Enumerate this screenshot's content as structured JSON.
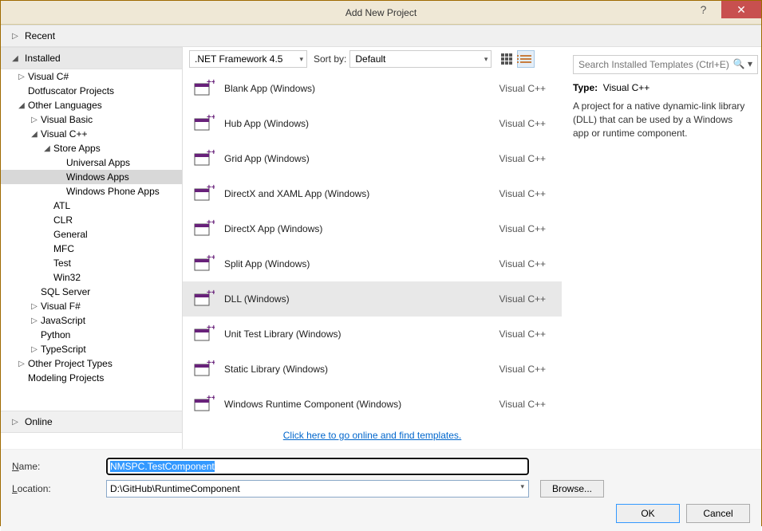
{
  "titlebar": {
    "title": "Add New Project"
  },
  "nav": {
    "recent": "Recent",
    "installed": "Installed",
    "online": "Online"
  },
  "toolbar": {
    "framework": ".NET Framework 4.5",
    "sort_label": "Sort by:",
    "sort_value": "Default",
    "search_placeholder": "Search Installed Templates (Ctrl+E)"
  },
  "tree": {
    "visual_csharp": "Visual C#",
    "dotfuscator": "Dotfuscator Projects",
    "other_languages": "Other Languages",
    "visual_basic": "Visual Basic",
    "visual_cpp": "Visual C++",
    "store_apps": "Store Apps",
    "universal": "Universal Apps",
    "windows_apps": "Windows Apps",
    "windows_phone": "Windows Phone Apps",
    "atl": "ATL",
    "clr": "CLR",
    "general": "General",
    "mfc": "MFC",
    "test": "Test",
    "win32": "Win32",
    "sql_server": "SQL Server",
    "visual_fsharp": "Visual F#",
    "javascript": "JavaScript",
    "python": "Python",
    "typescript": "TypeScript",
    "other_project_types": "Other Project Types",
    "modeling": "Modeling Projects"
  },
  "templates": [
    {
      "name": "Blank App (Windows)",
      "lang": "Visual C++"
    },
    {
      "name": "Hub App (Windows)",
      "lang": "Visual C++"
    },
    {
      "name": "Grid App (Windows)",
      "lang": "Visual C++"
    },
    {
      "name": "DirectX and XAML App (Windows)",
      "lang": "Visual C++"
    },
    {
      "name": "DirectX App (Windows)",
      "lang": "Visual C++"
    },
    {
      "name": "Split App (Windows)",
      "lang": "Visual C++"
    },
    {
      "name": "DLL (Windows)",
      "lang": "Visual C++"
    },
    {
      "name": "Unit Test Library (Windows)",
      "lang": "Visual C++"
    },
    {
      "name": "Static Library (Windows)",
      "lang": "Visual C++"
    },
    {
      "name": "Windows Runtime Component (Windows)",
      "lang": "Visual C++"
    }
  ],
  "selected_template_index": 6,
  "right": {
    "type_label": "Type:",
    "type_value": "Visual C++",
    "description": "A project for a native dynamic-link library (DLL) that can be used by a Windows app or runtime component."
  },
  "online_link": "Click here to go online and find templates.",
  "form": {
    "name_label": "Name:",
    "name_value": "NMSPC.TestComponent",
    "location_label": "Location:",
    "location_value": "D:\\GitHub\\RuntimeComponent",
    "browse": "Browse..."
  },
  "buttons": {
    "ok": "OK",
    "cancel": "Cancel"
  }
}
